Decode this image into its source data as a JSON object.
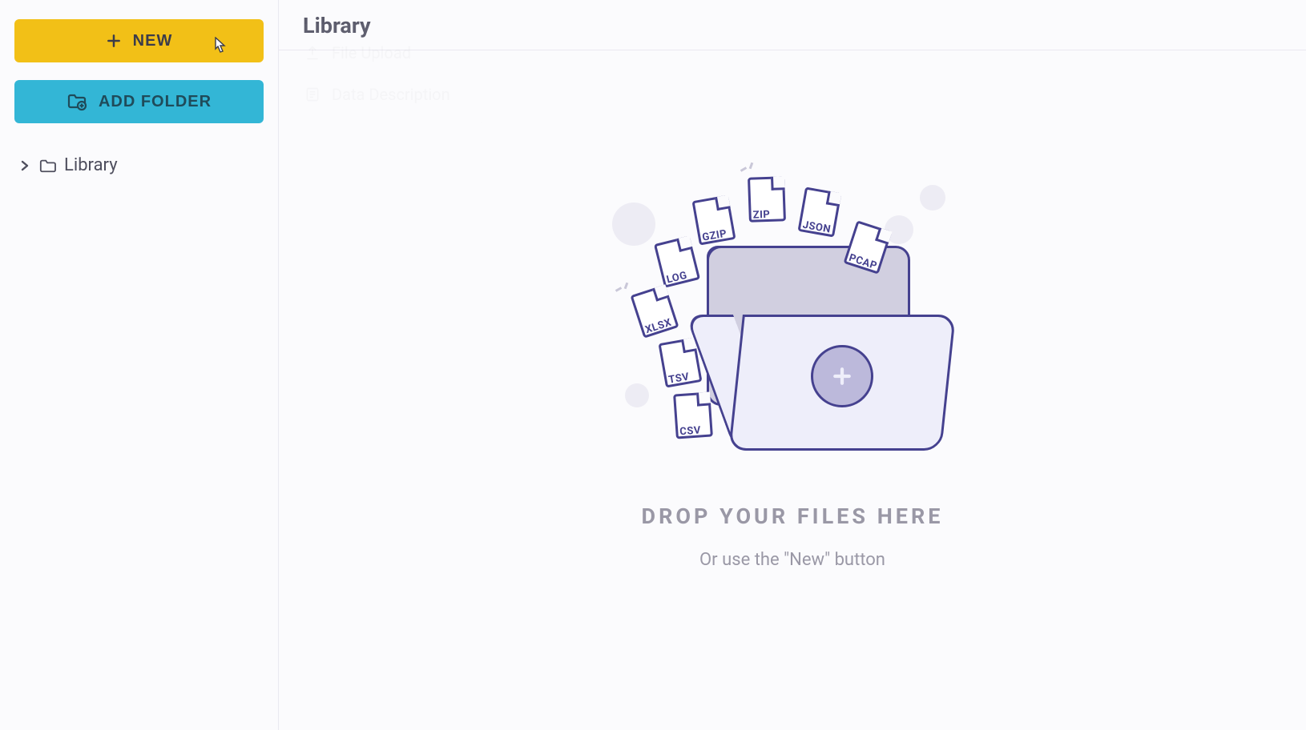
{
  "sidebar": {
    "new_label": "NEW",
    "add_folder_label": "ADD FOLDER",
    "tree": {
      "root_label": "Library"
    }
  },
  "dropdown": {
    "file_upload": "File Upload",
    "data_description": "Data Description"
  },
  "main": {
    "title": "Library",
    "drop_title": "DROP YOUR FILES HERE",
    "drop_sub": "Or use the \"New\" button"
  },
  "illustration": {
    "file_types": [
      "GZIP",
      "ZIP",
      "JSON",
      "PCAP",
      "LOG",
      "XLSX",
      "TSV",
      "CSV"
    ]
  }
}
